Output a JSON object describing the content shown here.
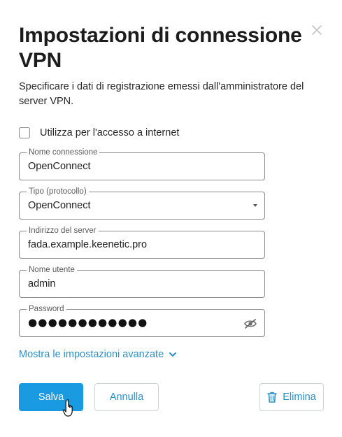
{
  "dialog": {
    "title": "Impostazioni di connessione VPN",
    "subtitle": "Specificare i dati di registrazione emessi dall'amministratore del server VPN.",
    "close_icon": "close-icon"
  },
  "internet_access": {
    "label": "Utilizza per l'accesso a internet",
    "checked": false
  },
  "fields": {
    "connection_name": {
      "label": "Nome connessione",
      "value": "OpenConnect"
    },
    "protocol_type": {
      "label": "Tipo (protocollo)",
      "value": "OpenConnect",
      "icon": "dropdown-caret-icon"
    },
    "server_address": {
      "label": "Indirizzo del server",
      "value": "fada.example.keenetic.pro"
    },
    "username": {
      "label": "Nome utente",
      "value": "admin"
    },
    "password": {
      "label": "Password",
      "value": "●●●●●●●●●●●●",
      "icon": "eye-off-icon"
    }
  },
  "advanced": {
    "label": "Mostra le impostazioni avanzate",
    "icon": "chevron-down-icon"
  },
  "actions": {
    "save_label": "Salva",
    "cancel_label": "Annulla",
    "delete_label": "Elimina",
    "delete_icon": "trash-icon"
  },
  "colors": {
    "accent": "#1a9ae0",
    "link": "#2a8fc7",
    "border": "#8a8a8a"
  }
}
